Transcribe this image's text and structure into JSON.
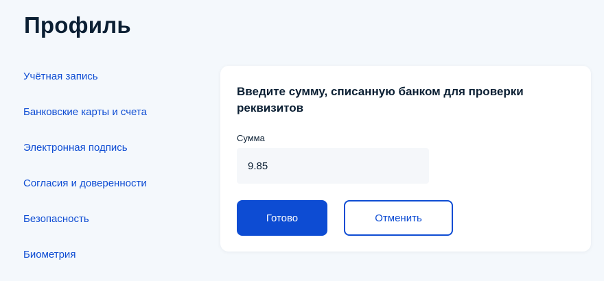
{
  "header": {
    "title": "Профиль"
  },
  "sidebar": {
    "items": [
      {
        "label": "Учётная запись"
      },
      {
        "label": "Банковские карты и счета"
      },
      {
        "label": "Электронная подпись"
      },
      {
        "label": "Согласия и доверенности"
      },
      {
        "label": "Безопасность"
      },
      {
        "label": "Биометрия"
      }
    ]
  },
  "card": {
    "heading": "Введите сумму, списанную банком для проверки реквизитов",
    "amount_label": "Сумма",
    "amount_value": "9.85",
    "submit_label": "Готово",
    "cancel_label": "Отменить"
  },
  "colors": {
    "accent": "#0d4cd3",
    "text": "#0b1f33",
    "background": "#f4f8fc",
    "input_background": "#f5f7fa"
  }
}
